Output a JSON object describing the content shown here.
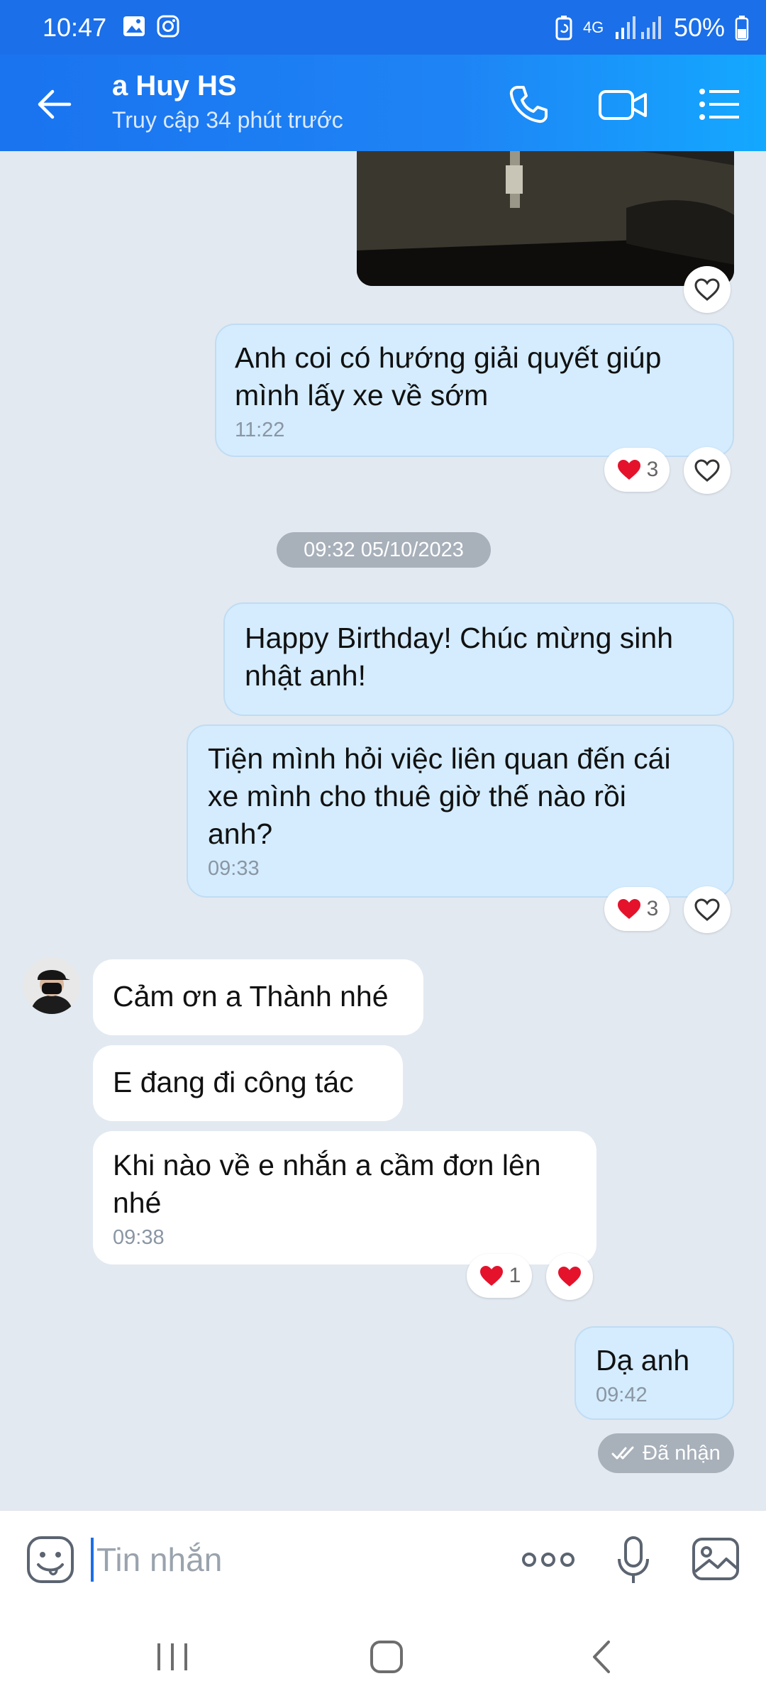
{
  "status_bar": {
    "time": "10:47",
    "network": "4G",
    "battery": "50%"
  },
  "header": {
    "contact_name": "a Huy HS",
    "last_seen": "Truy cập 34 phút trước"
  },
  "messages": {
    "m1": {
      "text": "Anh coi có hướng giải quyết giúp\nmình lấy xe về sớm",
      "time": "11:22",
      "reaction_count": "3"
    },
    "date_separator": "09:32 05/10/2023",
    "m2": {
      "text": "Happy Birthday! Chúc mừng sinh\nnhật anh!"
    },
    "m3": {
      "text": "Tiện mình hỏi việc liên quan đến cái\nxe mình cho thuê giờ thế nào rồi\nanh?",
      "time": "09:33",
      "reaction_count": "3"
    },
    "m4": {
      "text": "Cảm ơn a Thành nhé"
    },
    "m5": {
      "text": "E đang đi công tác"
    },
    "m6": {
      "text": "Khi nào về e nhắn a cầm đơn lên\nnhé",
      "time": "09:38",
      "reaction_count": "1"
    },
    "m7": {
      "text": "Dạ anh",
      "time": "09:42"
    },
    "delivery_status": "Đã nhận"
  },
  "composer": {
    "placeholder": "Tin nhắn"
  },
  "colors": {
    "header_blue": "#1a73ef",
    "outgoing_bubble": "#d4ecfe",
    "incoming_bubble": "#ffffff",
    "chat_background": "#e2e9f1",
    "heart_red": "#e5122c"
  },
  "icons": [
    "gallery-icon",
    "instagram-icon",
    "battery-saver-icon",
    "signal-icon",
    "battery-icon",
    "back-arrow-icon",
    "phone-icon",
    "video-call-icon",
    "menu-list-icon",
    "heart-outline-icon",
    "heart-filled-icon",
    "double-check-icon",
    "sticker-icon",
    "more-icon",
    "microphone-icon",
    "image-icon",
    "nav-recents-icon",
    "nav-home-icon",
    "nav-back-icon"
  ]
}
